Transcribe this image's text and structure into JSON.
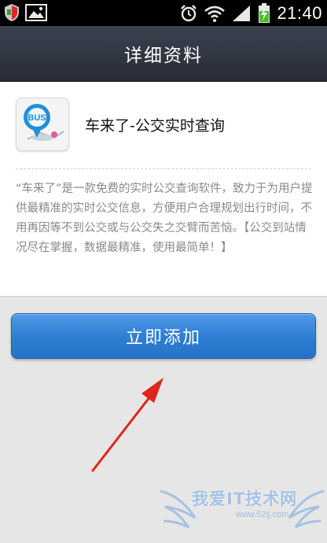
{
  "status_bar": {
    "time": "21:40",
    "icons": [
      "shield-icon",
      "image-icon",
      "alarm-icon",
      "wifi-icon",
      "signal-icon",
      "battery-charging-icon"
    ]
  },
  "header": {
    "title": "详细资料"
  },
  "app": {
    "icon_text": "BUS",
    "name": "车来了-公交实时查询",
    "description": "“车来了”是一款免费的实时公交查询软件，致力于为用户提供最精准的实时公交信息，方便用户合理规划出行时间，不用再因等不到公交或与公交失之交臂而苦恼。【公交到站情况尽在掌握，数据最精准，使用最简单！】"
  },
  "actions": {
    "add_label": "立即添加"
  },
  "watermark": {
    "text": "我爱IT技术网",
    "url": "www.52ij.com"
  },
  "colors": {
    "header_bg": "#2f3540",
    "button_blue": "#2f7fd4",
    "arrow_red": "#e0261c"
  }
}
